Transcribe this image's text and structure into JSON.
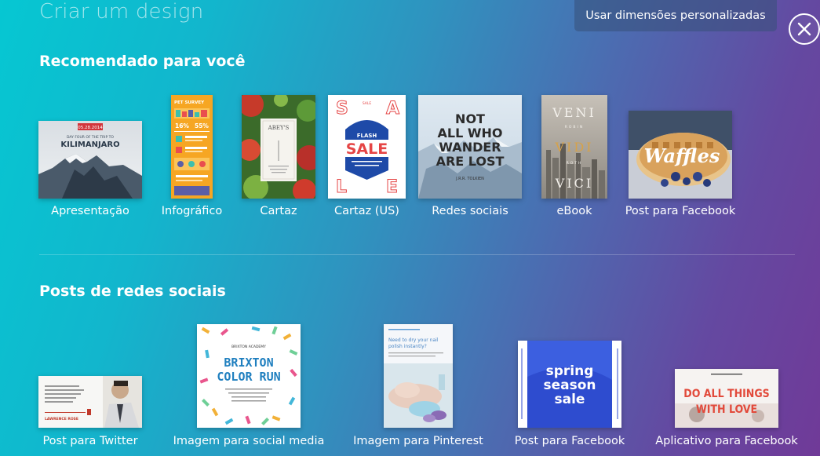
{
  "header": {
    "title": "Criar um design",
    "custom_dimensions_label": "Usar dimensões personalizadas"
  },
  "sections": {
    "recommended": {
      "title": "Recomendado para você",
      "items": [
        {
          "label": "Apresentação",
          "thumb_text": [
            "DAY FOUR OF THE TRIP TO",
            "KILIMANJARO",
            "05.28.2014"
          ]
        },
        {
          "label": "Infográfico",
          "thumb_text": [
            "PET SURVEY",
            "16%",
            "55%"
          ]
        },
        {
          "label": "Cartaz",
          "thumb_text": [
            "ABEY'S"
          ]
        },
        {
          "label": "Cartaz (US)",
          "thumb_text": [
            "FLASH",
            "SALE",
            "SALE"
          ]
        },
        {
          "label": "Redes sociais",
          "thumb_text": [
            "NOT",
            "ALL WHO",
            "WANDER",
            "ARE LOST",
            "J.R.R. TOLKIEN"
          ]
        },
        {
          "label": "eBook",
          "thumb_text": [
            "VENI",
            "ROBIN",
            "VIDI",
            "ROTH",
            "VICI"
          ]
        },
        {
          "label": "Post para Facebook",
          "thumb_text": [
            "Waffles"
          ]
        }
      ]
    },
    "social": {
      "title": "Posts de redes sociais",
      "items": [
        {
          "label": "Post para Twitter",
          "thumb_text": [
            "LAWRENCE ROSE"
          ]
        },
        {
          "label": "Imagem para social media",
          "thumb_text": [
            "BRIXTON ACADEMY",
            "BRIXTON",
            "COLOR RUN"
          ]
        },
        {
          "label": "Imagem para Pinterest",
          "thumb_text": [
            "Need to dry your nail",
            "polish instantly?"
          ]
        },
        {
          "label": "Post para Facebook",
          "thumb_text": [
            "spring",
            "season",
            "sale"
          ]
        },
        {
          "label": "Aplicativo para Facebook",
          "thumb_text": [
            "DO ALL THINGS",
            "WITH LOVE"
          ]
        }
      ]
    }
  },
  "colors": {
    "gradient_start": "#06c7d2",
    "gradient_end": "#703a98",
    "button_bg": "#375078"
  }
}
